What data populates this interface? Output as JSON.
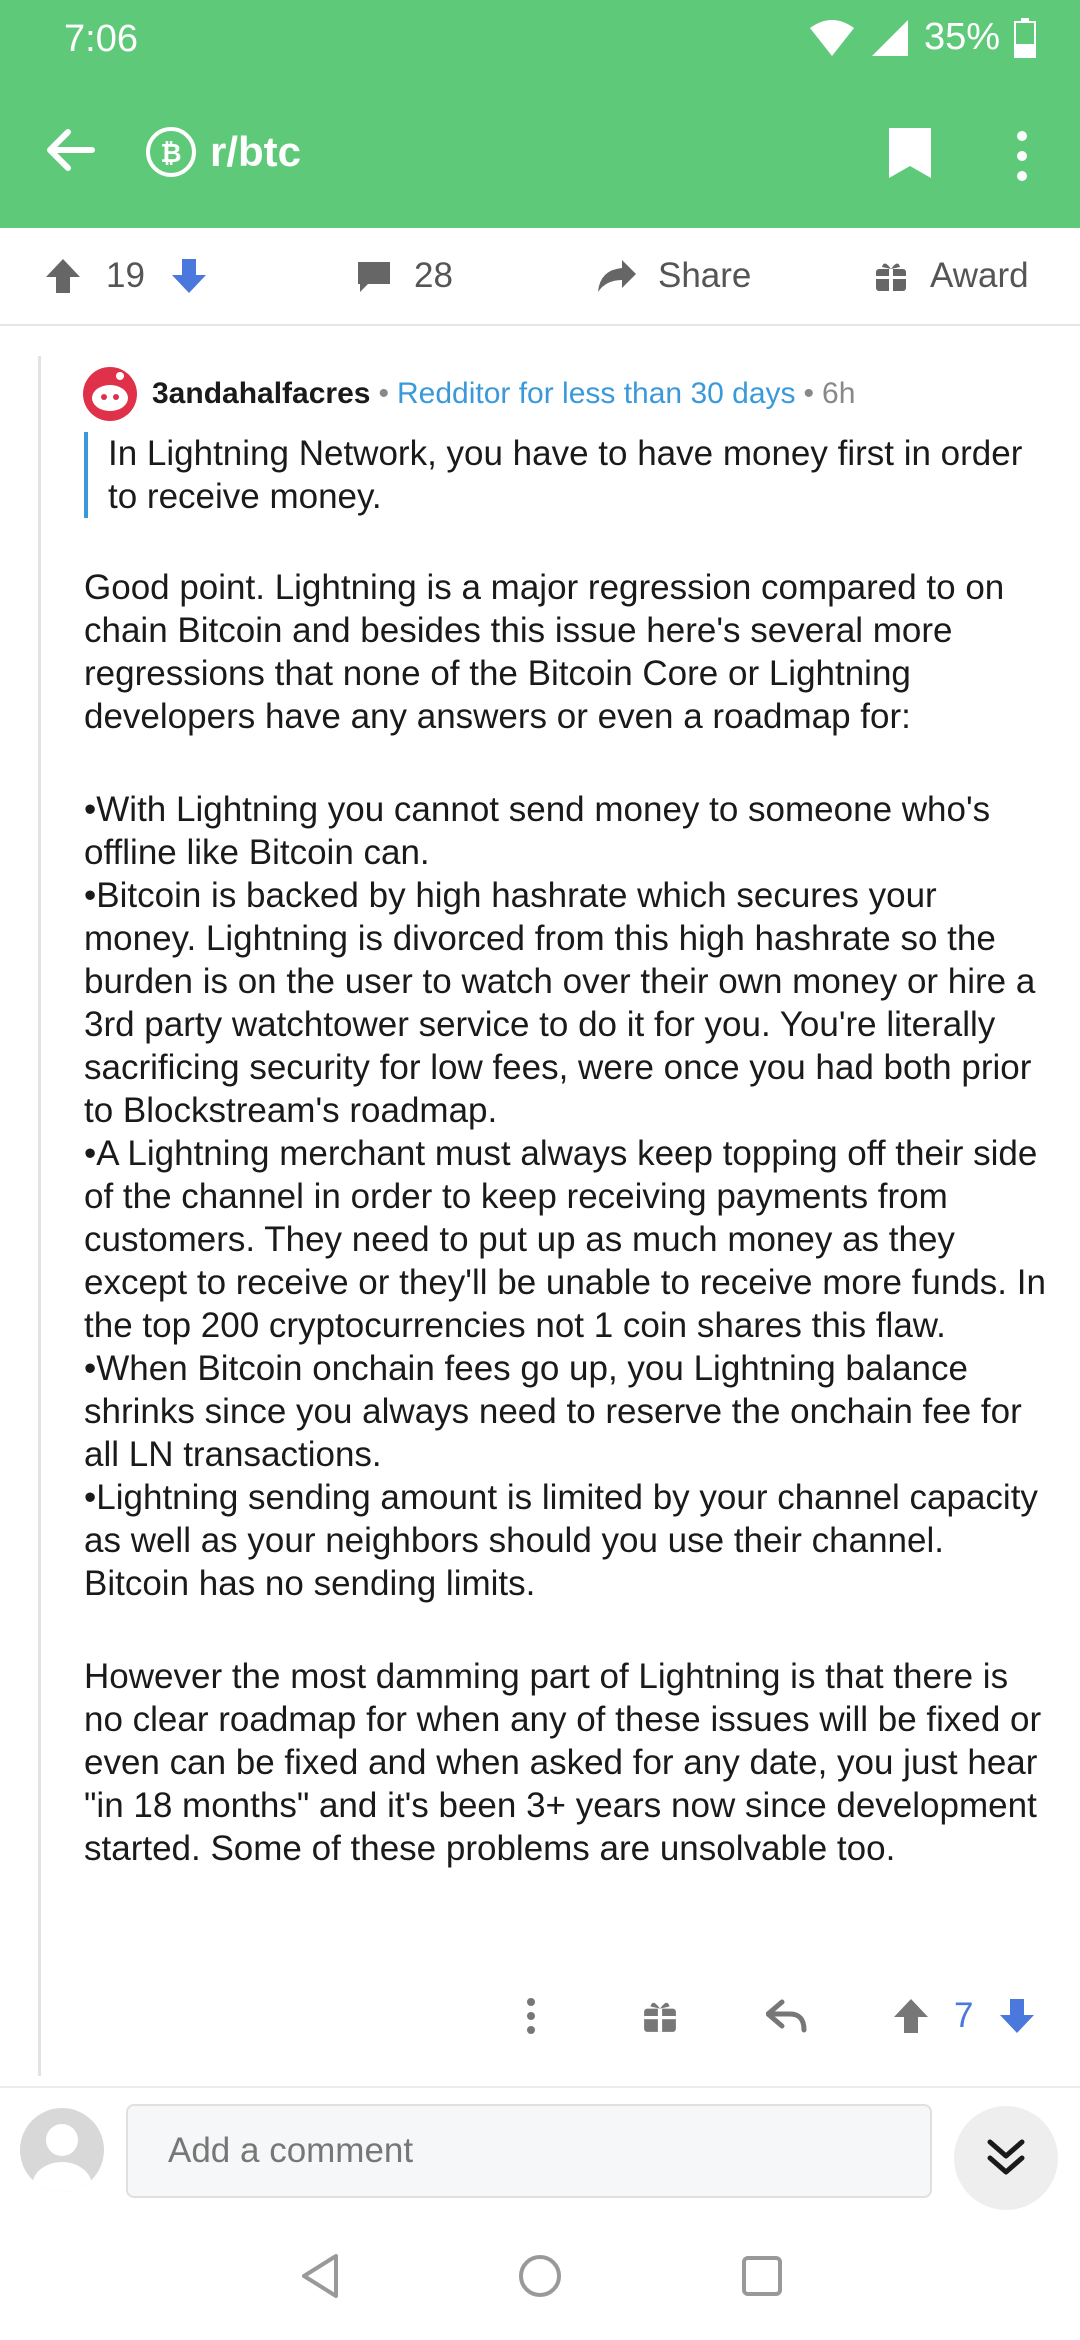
{
  "status_bar": {
    "time": "7:06",
    "battery": "35%"
  },
  "app_bar": {
    "subreddit": "r/btc"
  },
  "post_actions": {
    "score": "19",
    "comments": "28",
    "share": "Share",
    "award": "Award"
  },
  "comment": {
    "author": "3andahalfacres",
    "flair": "Redditor for less than 30 days",
    "age": "6h",
    "quote": "In Lightning Network, you have to have money first in order to receive money.",
    "intro": "Good point. Lightning is a major regression compared to on chain Bitcoin and besides this issue here's several more regressions that none of the Bitcoin Core or Lightning developers have any answers or even a roadmap for:",
    "points": [
      "With Lightning you cannot send money to someone who's offline like Bitcoin can.",
      "Bitcoin is backed by high hashrate which secures your money. Lightning is divorced from this high hashrate so the burden is on the user to watch over their own money or hire a 3rd party watchtower service to do it for you. You're literally sacrificing security for low fees, were once you had both prior to Blockstream's roadmap.",
      "A Lightning merchant must always keep topping off their side of the channel in order to keep receiving payments from customers. They need to put up as much money as they except to receive or they'll be unable to receive more funds. In the top 200 cryptocurrencies not 1 coin shares this flaw.",
      "When Bitcoin onchain fees go up, you Lightning balance shrinks since you always need to reserve the onchain fee for all LN transactions.",
      "Lightning sending amount is limited by your channel capacity as well as your neighbors should you use their channel. Bitcoin has no sending limits."
    ],
    "conclusion": "However the most damming part of Lightning is that there is no clear roadmap for when any of these issues will be fixed or even can be fixed and when asked for any date, you just hear \"in 18 months\" and it's been 3+ years now since development started. Some of these problems are unsolvable too.",
    "score": "7"
  },
  "composer": {
    "placeholder": "Add a comment"
  },
  "colors": {
    "app_bar": "#5fc97a",
    "upvote_blue": "#4a78dc",
    "flair_blue": "#3a9ad9"
  }
}
